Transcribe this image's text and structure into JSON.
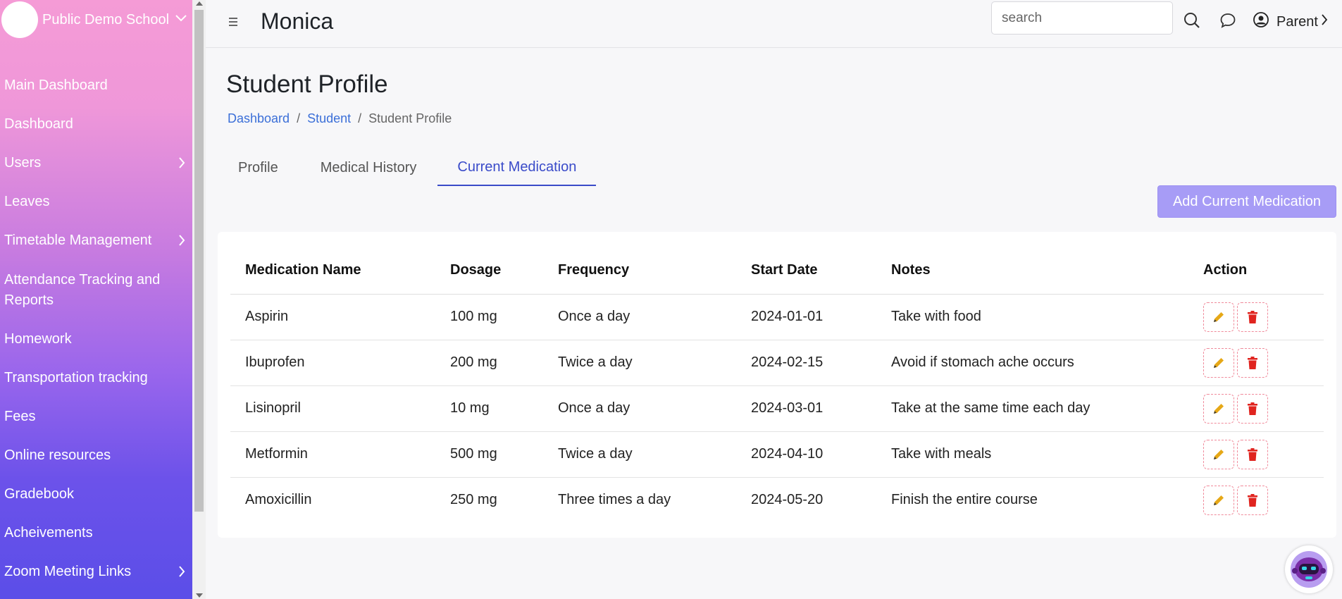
{
  "sidebar": {
    "school_name": "Public Demo School",
    "items": [
      {
        "label": "Main Dashboard",
        "has_chevron": false
      },
      {
        "label": "Dashboard",
        "has_chevron": false
      },
      {
        "label": "Users",
        "has_chevron": true
      },
      {
        "label": "Leaves",
        "has_chevron": false
      },
      {
        "label": "Timetable Management",
        "has_chevron": true
      },
      {
        "label": "Attendance Tracking and Reports",
        "has_chevron": false
      },
      {
        "label": "Homework",
        "has_chevron": false
      },
      {
        "label": "Transportation tracking",
        "has_chevron": false
      },
      {
        "label": "Fees",
        "has_chevron": false
      },
      {
        "label": "Online resources",
        "has_chevron": false
      },
      {
        "label": "Gradebook",
        "has_chevron": false
      },
      {
        "label": "Acheivements",
        "has_chevron": false
      },
      {
        "label": "Zoom Meeting Links",
        "has_chevron": true
      }
    ]
  },
  "header": {
    "title": "Monica",
    "search_placeholder": "search",
    "user_label": "Parent"
  },
  "main": {
    "page_title": "Student Profile",
    "breadcrumb": [
      "Dashboard",
      "Student",
      "Student Profile"
    ],
    "tabs": [
      {
        "label": "Profile",
        "active": false
      },
      {
        "label": "Medical History",
        "active": false
      },
      {
        "label": "Current Medication",
        "active": true
      }
    ],
    "add_button": "Add Current Medication",
    "table": {
      "headers": [
        "Medication Name",
        "Dosage",
        "Frequency",
        "Start Date",
        "Notes",
        "Action"
      ],
      "rows": [
        [
          "Aspirin",
          "100 mg",
          "Once a day",
          "2024-01-01",
          "Take with food"
        ],
        [
          "Ibuprofen",
          "200 mg",
          "Twice a day",
          "2024-02-15",
          "Avoid if stomach ache occurs"
        ],
        [
          "Lisinopril",
          "10 mg",
          "Once a day",
          "2024-03-01",
          "Take at the same time each day"
        ],
        [
          "Metformin",
          "500 mg",
          "Twice a day",
          "2024-04-10",
          "Take with meals"
        ],
        [
          "Amoxicillin",
          "250 mg",
          "Three times a day",
          "2024-05-20",
          "Finish the entire course"
        ]
      ]
    }
  },
  "colors": {
    "accent": "#3a4bc9",
    "button": "#a79cf6",
    "edit_icon": "#e6a817",
    "delete_icon": "#e0241f"
  }
}
